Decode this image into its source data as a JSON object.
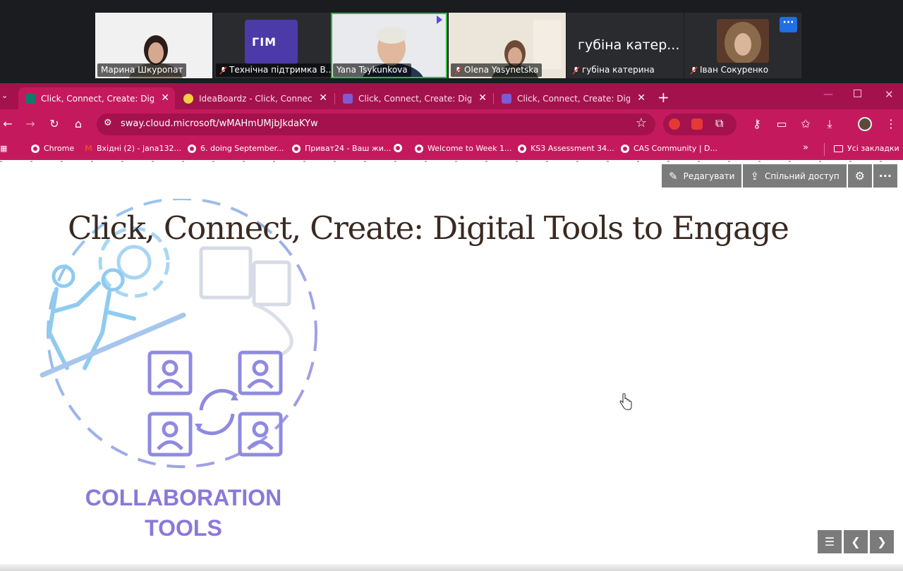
{
  "meeting": {
    "participants": [
      {
        "name": "Марина Шкуропат",
        "muted": false
      },
      {
        "name": "Технічна підтримка В...",
        "muted": true
      },
      {
        "name": "Yana Tsykunkova",
        "muted": false,
        "active": true
      },
      {
        "name": "Olena Yasynetska",
        "muted": true
      },
      {
        "name": "губіна катерина",
        "muted": true,
        "display_title": "губіна катер..."
      },
      {
        "name": "Іван Сокуренко",
        "muted": true
      }
    ],
    "logo_text": "ГІМ",
    "more_icon": "ellipsis-icon"
  },
  "browser": {
    "tabs": [
      {
        "title": "Click, Connect, Create: Digital T",
        "active": true,
        "icon": "sway-icon"
      },
      {
        "title": "IdeaBoardz - Click, Connect, Cr",
        "active": false,
        "icon": "lightbulb-icon"
      },
      {
        "title": "Click, Connect, Create: Digital T",
        "active": false,
        "icon": "forms-icon"
      },
      {
        "title": "Click, Connect, Create: Digital T",
        "active": false,
        "icon": "forms-icon"
      }
    ],
    "new_tab": "+",
    "url": "sway.cloud.microsoft/wMAHmUMjbJkdaKYw",
    "bookmarks": [
      {
        "label": "Chrome"
      },
      {
        "label": "Вхідні (2) - jana132..."
      },
      {
        "label": "6. doing September..."
      },
      {
        "label": "Приват24 - Ваш жи..."
      },
      {
        "label": "Welcome to Week 1..."
      },
      {
        "label": "KS3 Assessment 34..."
      },
      {
        "label": "CAS Community | D..."
      }
    ],
    "all_bookmarks": "Усі закладки"
  },
  "sway": {
    "toolbar": {
      "edit_label": "Редагувати",
      "share_label": "Спільний доступ"
    },
    "title": "Click, Connect, Create: Digital Tools to Engage",
    "image_text_line1": "COLLABORATION",
    "image_text_line2": "TOOLS"
  },
  "colors": {
    "browser_dark": "#a3124d",
    "browser_main": "#c41a5d",
    "title_color": "#3a2a22",
    "illustration_purple": "#8a78d9",
    "illustration_blue": "#7fc3ee"
  }
}
